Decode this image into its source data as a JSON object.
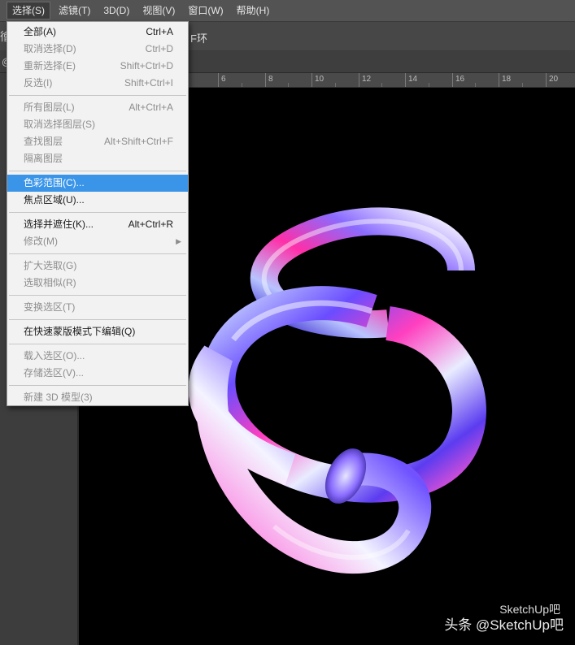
{
  "menubar": {
    "items": [
      {
        "label": "选择(S)",
        "active": true
      },
      {
        "label": "滤镜(T)"
      },
      {
        "label": "3D(D)"
      },
      {
        "label": "视图(V)"
      },
      {
        "label": "窗口(W)"
      },
      {
        "label": "帮助(H)"
      }
    ]
  },
  "optionsbar": {
    "left_fragment": "徻",
    "text": "F环"
  },
  "tabrow": {
    "left_fragment": "@"
  },
  "ruler": {
    "labels": [
      "6",
      "8",
      "10",
      "12",
      "14",
      "16",
      "18",
      "20"
    ]
  },
  "select_menu": {
    "items": [
      {
        "label": "全部(A)",
        "shortcut": "Ctrl+A",
        "state": "enabled"
      },
      {
        "label": "取消选择(D)",
        "shortcut": "Ctrl+D",
        "state": "disabled"
      },
      {
        "label": "重新选择(E)",
        "shortcut": "Shift+Ctrl+D",
        "state": "disabled"
      },
      {
        "label": "反选(I)",
        "shortcut": "Shift+Ctrl+I",
        "state": "disabled"
      },
      {
        "label": "所有图层(L)",
        "shortcut": "Alt+Ctrl+A",
        "state": "disabled"
      },
      {
        "label": "取消选择图层(S)",
        "shortcut": "",
        "state": "disabled"
      },
      {
        "label": "查找图层",
        "shortcut": "Alt+Shift+Ctrl+F",
        "state": "disabled"
      },
      {
        "label": "隔离图层",
        "shortcut": "",
        "state": "disabled"
      },
      {
        "label": "色彩范围(C)...",
        "shortcut": "",
        "state": "highlighted"
      },
      {
        "label": "焦点区域(U)...",
        "shortcut": "",
        "state": "enabled"
      },
      {
        "label": "选择并遮住(K)...",
        "shortcut": "Alt+Ctrl+R",
        "state": "enabled"
      },
      {
        "label": "修改(M)",
        "shortcut": "",
        "state": "disabled",
        "submenu": true
      },
      {
        "label": "扩大选取(G)",
        "shortcut": "",
        "state": "disabled"
      },
      {
        "label": "选取相似(R)",
        "shortcut": "",
        "state": "disabled"
      },
      {
        "label": "变换选区(T)",
        "shortcut": "",
        "state": "disabled"
      },
      {
        "label": "在快速蒙版模式下编辑(Q)",
        "shortcut": "",
        "state": "enabled"
      },
      {
        "label": "载入选区(O)...",
        "shortcut": "",
        "state": "disabled"
      },
      {
        "label": "存储选区(V)...",
        "shortcut": "",
        "state": "disabled"
      },
      {
        "label": "新建 3D 模型(3)",
        "shortcut": "",
        "state": "disabled"
      }
    ]
  },
  "watermark": {
    "primary": "头条 @SketchUp吧",
    "secondary": "SketchUp吧"
  },
  "colors": {
    "highlight": "#3a95e8",
    "menu_bg": "#f2f2f2",
    "canvas_bg": "#000000"
  }
}
